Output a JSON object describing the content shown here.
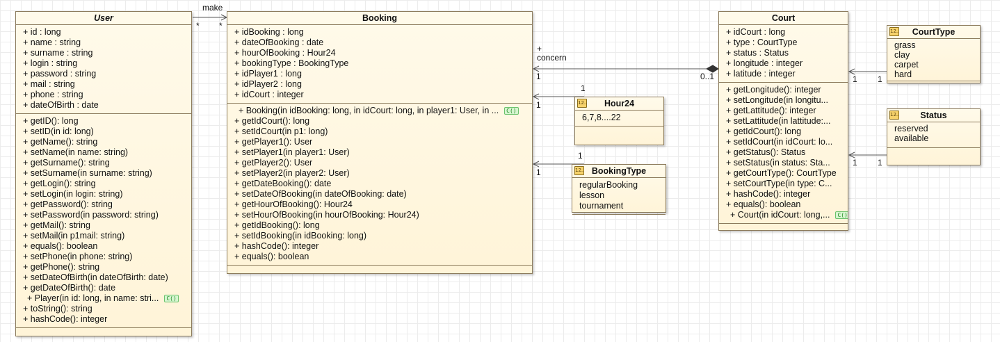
{
  "diagram_type": "UML class diagram",
  "classes": {
    "user": {
      "name": "User",
      "attributes": [
        "+ id : long",
        "+ name : string",
        "+ surname : string",
        "+ login : string",
        "+ password : string",
        "+ mail : string",
        "+ phone : string",
        "+ dateOfBirth : date"
      ],
      "operations": [
        "+ getID(): long",
        "+ setID(in id: long)",
        "+ getName(): string",
        "+ setName(in name: string)",
        "+ getSurname(): string",
        "+ setSurname(in surname: string)",
        "+ getLogin(): string",
        "+ setLogin(in login: string)",
        "+ getPassword(): string",
        "+ setPassword(in password: string)",
        "+ getMail(): string",
        "+ setMail(in p1mail: string)",
        "+ equals(): boolean",
        "+ setPhone(in phone: string)",
        "+ getPhone(): string",
        "+ setDateOfBirth(in dateOfBirth: date)",
        "+ getDateOfBirth(): date",
        "+ Player(in id: long, in name: stri...",
        "+ toString(): string",
        "+ hashCode(): integer"
      ],
      "constructor": "+ Player(in id: long, in name: stri..."
    },
    "booking": {
      "name": "Booking",
      "attributes": [
        "+ idBooking : long",
        "+ dateOfBooking : date",
        "+ hourOfBooking : Hour24",
        "+ bookingType : BookingType",
        "+ idPlayer1 : long",
        "+ idPlayer2 : long",
        "+ idCourt : integer"
      ],
      "operations": [
        "+ Booking(in idBooking: long, in idCourt: long, in player1: User, in ...",
        "+ getIdCourt(): long",
        "+ setIdCourt(in p1: long)",
        "+ getPlayer1(): User",
        "+ setPlayer1(in player1: User)",
        "+ getPlayer2(): User",
        "+ setPlayer2(in player2: User)",
        "+ getDateBooking(): date",
        "+ setDateOfBooking(in dateOfBooking: date)",
        "+ getHourOfBooking(): Hour24",
        "+ setHourOfBooking(in hourOfBooking: Hour24)",
        "+ getIdBooking(): long",
        "+ setIdBooking(in idBooking: long)",
        "+ hashCode(): integer",
        "+ equals(): boolean"
      ],
      "constructor": "+ Booking(in idBooking: long, in idCourt: long, in player1: User, in ..."
    },
    "court": {
      "name": "Court",
      "attributes": [
        "+ idCourt : long",
        "+ type : CourtType",
        "+ status : Status",
        "+ longitude : integer",
        "+ latitude : integer"
      ],
      "operations": [
        "+ getLongitude(): integer",
        "+ setLongitude(in longitu...",
        "+ getLattitude(): integer",
        "+ setLattitude(in lattitude:...",
        "+ getIdCourt(): long",
        "+ setIdCourt(in idCourt: lo...",
        "+ getStatus(): Status",
        "+ setStatus(in status: Sta...",
        "+ getCourtType(): CourtType",
        "+ setCourtType(in type: C...",
        "+ hashCode(): integer",
        "+ equals(): boolean",
        "+ Court(in idCourt: long,..."
      ],
      "constructor": "+ Court(in idCourt: long,..."
    }
  },
  "enums": {
    "hour24": {
      "name": "Hour24",
      "values": [
        "6,7,8....22"
      ]
    },
    "bookingType": {
      "name": "BookingType",
      "values": [
        "regularBooking",
        "lesson",
        "tournament"
      ]
    },
    "courtType": {
      "name": "CourtType",
      "values": [
        "grass",
        "clay",
        "carpet",
        "hard"
      ]
    },
    "status": {
      "name": "Status",
      "values": [
        "reserved",
        "available"
      ]
    }
  },
  "icons": {
    "enum": "12..",
    "constructor": "C()"
  },
  "edges": [
    {
      "from": "User",
      "to": "Booking",
      "kind": "association",
      "label": "make",
      "from_mult": "*",
      "to_mult": "*"
    },
    {
      "from": "Court",
      "to": "Booking",
      "kind": "composition",
      "label": "+\nconcern",
      "from_mult": "0..1",
      "to_mult": "1"
    },
    {
      "from": "Hour24",
      "to": "Booking",
      "kind": "association",
      "from_mult": "1",
      "to_mult": "1"
    },
    {
      "from": "BookingType",
      "to": "Booking",
      "kind": "association",
      "from_mult": "1",
      "to_mult": "1"
    },
    {
      "from": "CourtType",
      "to": "Court",
      "kind": "association",
      "from_mult": "1",
      "to_mult": "1"
    },
    {
      "from": "Status",
      "to": "Court",
      "kind": "association",
      "from_mult": "1",
      "to_mult": "1"
    }
  ],
  "colors": {
    "box_fill": "#fff6dc",
    "box_border": "#8c7b5c",
    "line": "#555555",
    "grid": "#ececec"
  }
}
